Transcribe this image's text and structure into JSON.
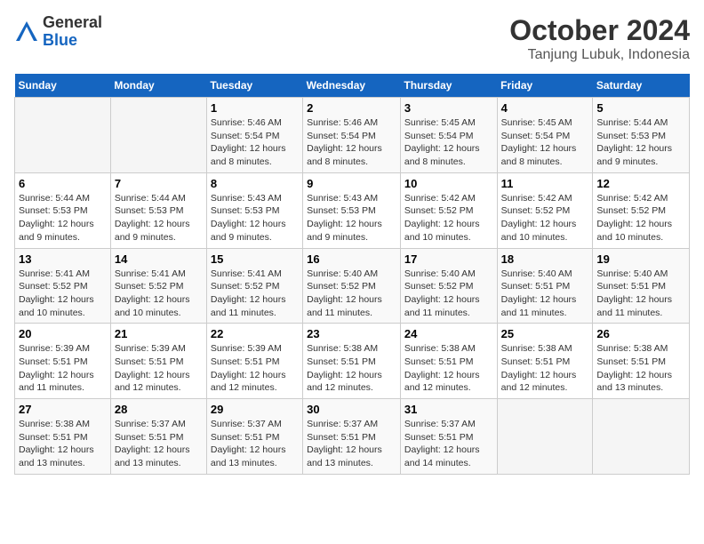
{
  "header": {
    "logo_general": "General",
    "logo_blue": "Blue",
    "month_title": "October 2024",
    "location": "Tanjung Lubuk, Indonesia"
  },
  "weekdays": [
    "Sunday",
    "Monday",
    "Tuesday",
    "Wednesday",
    "Thursday",
    "Friday",
    "Saturday"
  ],
  "weeks": [
    [
      {
        "day": "",
        "sunrise": "",
        "sunset": "",
        "daylight": ""
      },
      {
        "day": "",
        "sunrise": "",
        "sunset": "",
        "daylight": ""
      },
      {
        "day": "1",
        "sunrise": "Sunrise: 5:46 AM",
        "sunset": "Sunset: 5:54 PM",
        "daylight": "Daylight: 12 hours and 8 minutes."
      },
      {
        "day": "2",
        "sunrise": "Sunrise: 5:46 AM",
        "sunset": "Sunset: 5:54 PM",
        "daylight": "Daylight: 12 hours and 8 minutes."
      },
      {
        "day": "3",
        "sunrise": "Sunrise: 5:45 AM",
        "sunset": "Sunset: 5:54 PM",
        "daylight": "Daylight: 12 hours and 8 minutes."
      },
      {
        "day": "4",
        "sunrise": "Sunrise: 5:45 AM",
        "sunset": "Sunset: 5:54 PM",
        "daylight": "Daylight: 12 hours and 8 minutes."
      },
      {
        "day": "5",
        "sunrise": "Sunrise: 5:44 AM",
        "sunset": "Sunset: 5:53 PM",
        "daylight": "Daylight: 12 hours and 9 minutes."
      }
    ],
    [
      {
        "day": "6",
        "sunrise": "Sunrise: 5:44 AM",
        "sunset": "Sunset: 5:53 PM",
        "daylight": "Daylight: 12 hours and 9 minutes."
      },
      {
        "day": "7",
        "sunrise": "Sunrise: 5:44 AM",
        "sunset": "Sunset: 5:53 PM",
        "daylight": "Daylight: 12 hours and 9 minutes."
      },
      {
        "day": "8",
        "sunrise": "Sunrise: 5:43 AM",
        "sunset": "Sunset: 5:53 PM",
        "daylight": "Daylight: 12 hours and 9 minutes."
      },
      {
        "day": "9",
        "sunrise": "Sunrise: 5:43 AM",
        "sunset": "Sunset: 5:53 PM",
        "daylight": "Daylight: 12 hours and 9 minutes."
      },
      {
        "day": "10",
        "sunrise": "Sunrise: 5:42 AM",
        "sunset": "Sunset: 5:52 PM",
        "daylight": "Daylight: 12 hours and 10 minutes."
      },
      {
        "day": "11",
        "sunrise": "Sunrise: 5:42 AM",
        "sunset": "Sunset: 5:52 PM",
        "daylight": "Daylight: 12 hours and 10 minutes."
      },
      {
        "day": "12",
        "sunrise": "Sunrise: 5:42 AM",
        "sunset": "Sunset: 5:52 PM",
        "daylight": "Daylight: 12 hours and 10 minutes."
      }
    ],
    [
      {
        "day": "13",
        "sunrise": "Sunrise: 5:41 AM",
        "sunset": "Sunset: 5:52 PM",
        "daylight": "Daylight: 12 hours and 10 minutes."
      },
      {
        "day": "14",
        "sunrise": "Sunrise: 5:41 AM",
        "sunset": "Sunset: 5:52 PM",
        "daylight": "Daylight: 12 hours and 10 minutes."
      },
      {
        "day": "15",
        "sunrise": "Sunrise: 5:41 AM",
        "sunset": "Sunset: 5:52 PM",
        "daylight": "Daylight: 12 hours and 11 minutes."
      },
      {
        "day": "16",
        "sunrise": "Sunrise: 5:40 AM",
        "sunset": "Sunset: 5:52 PM",
        "daylight": "Daylight: 12 hours and 11 minutes."
      },
      {
        "day": "17",
        "sunrise": "Sunrise: 5:40 AM",
        "sunset": "Sunset: 5:52 PM",
        "daylight": "Daylight: 12 hours and 11 minutes."
      },
      {
        "day": "18",
        "sunrise": "Sunrise: 5:40 AM",
        "sunset": "Sunset: 5:51 PM",
        "daylight": "Daylight: 12 hours and 11 minutes."
      },
      {
        "day": "19",
        "sunrise": "Sunrise: 5:40 AM",
        "sunset": "Sunset: 5:51 PM",
        "daylight": "Daylight: 12 hours and 11 minutes."
      }
    ],
    [
      {
        "day": "20",
        "sunrise": "Sunrise: 5:39 AM",
        "sunset": "Sunset: 5:51 PM",
        "daylight": "Daylight: 12 hours and 11 minutes."
      },
      {
        "day": "21",
        "sunrise": "Sunrise: 5:39 AM",
        "sunset": "Sunset: 5:51 PM",
        "daylight": "Daylight: 12 hours and 12 minutes."
      },
      {
        "day": "22",
        "sunrise": "Sunrise: 5:39 AM",
        "sunset": "Sunset: 5:51 PM",
        "daylight": "Daylight: 12 hours and 12 minutes."
      },
      {
        "day": "23",
        "sunrise": "Sunrise: 5:38 AM",
        "sunset": "Sunset: 5:51 PM",
        "daylight": "Daylight: 12 hours and 12 minutes."
      },
      {
        "day": "24",
        "sunrise": "Sunrise: 5:38 AM",
        "sunset": "Sunset: 5:51 PM",
        "daylight": "Daylight: 12 hours and 12 minutes."
      },
      {
        "day": "25",
        "sunrise": "Sunrise: 5:38 AM",
        "sunset": "Sunset: 5:51 PM",
        "daylight": "Daylight: 12 hours and 12 minutes."
      },
      {
        "day": "26",
        "sunrise": "Sunrise: 5:38 AM",
        "sunset": "Sunset: 5:51 PM",
        "daylight": "Daylight: 12 hours and 13 minutes."
      }
    ],
    [
      {
        "day": "27",
        "sunrise": "Sunrise: 5:38 AM",
        "sunset": "Sunset: 5:51 PM",
        "daylight": "Daylight: 12 hours and 13 minutes."
      },
      {
        "day": "28",
        "sunrise": "Sunrise: 5:37 AM",
        "sunset": "Sunset: 5:51 PM",
        "daylight": "Daylight: 12 hours and 13 minutes."
      },
      {
        "day": "29",
        "sunrise": "Sunrise: 5:37 AM",
        "sunset": "Sunset: 5:51 PM",
        "daylight": "Daylight: 12 hours and 13 minutes."
      },
      {
        "day": "30",
        "sunrise": "Sunrise: 5:37 AM",
        "sunset": "Sunset: 5:51 PM",
        "daylight": "Daylight: 12 hours and 13 minutes."
      },
      {
        "day": "31",
        "sunrise": "Sunrise: 5:37 AM",
        "sunset": "Sunset: 5:51 PM",
        "daylight": "Daylight: 12 hours and 14 minutes."
      },
      {
        "day": "",
        "sunrise": "",
        "sunset": "",
        "daylight": ""
      },
      {
        "day": "",
        "sunrise": "",
        "sunset": "",
        "daylight": ""
      }
    ]
  ]
}
